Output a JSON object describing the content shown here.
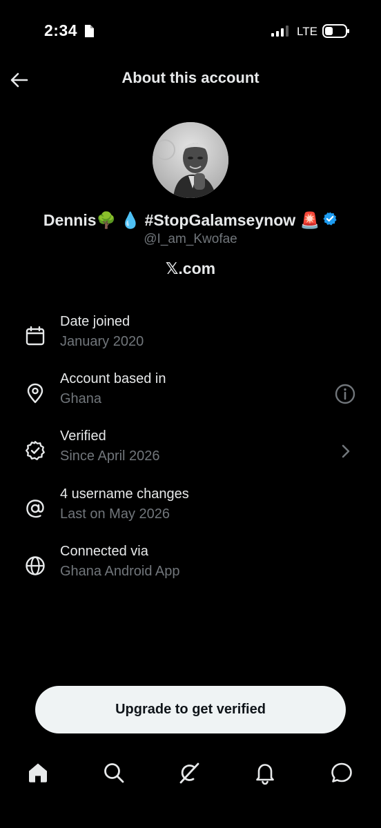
{
  "status_bar": {
    "time": "2:34",
    "network": "LTE",
    "icons": [
      "document-icon",
      "signal-icon",
      "battery-icon"
    ]
  },
  "header": {
    "title": "About this account",
    "back_icon": "back-arrow-icon"
  },
  "profile": {
    "avatar_icon": "avatar",
    "display_name": "Dennis🌳 💧 #StopGalamseynow 🚨",
    "verified_icon": "verified-badge-icon",
    "handle": "@I_am_Kwofae",
    "domain": "𝕏.com"
  },
  "details": [
    {
      "icon": "calendar-icon",
      "label": "Date joined",
      "value": "January 2020"
    },
    {
      "icon": "location-pin-icon",
      "label": "Account based in",
      "value": "Ghana",
      "trailing_icon": "info-icon"
    },
    {
      "icon": "verified-badge-outline-icon",
      "label": "Verified",
      "value": "Since April 2026",
      "trailing_icon": "chevron-right-icon"
    },
    {
      "icon": "at-sign-icon",
      "label": "4 username changes",
      "value": "Last on May 2026"
    },
    {
      "icon": "globe-icon",
      "label": "Connected via",
      "value": "Ghana Android App"
    }
  ],
  "cta": {
    "label": "Upgrade to get verified"
  },
  "tab_bar": {
    "tabs": [
      "home-icon",
      "search-icon",
      "grok-icon",
      "notifications-icon",
      "messages-icon"
    ]
  },
  "colors": {
    "background": "#000000",
    "primary_text": "#e7e9ea",
    "secondary_text": "#71767b",
    "verified_blue": "#1d9bf0",
    "button_bg": "#eff3f4"
  }
}
